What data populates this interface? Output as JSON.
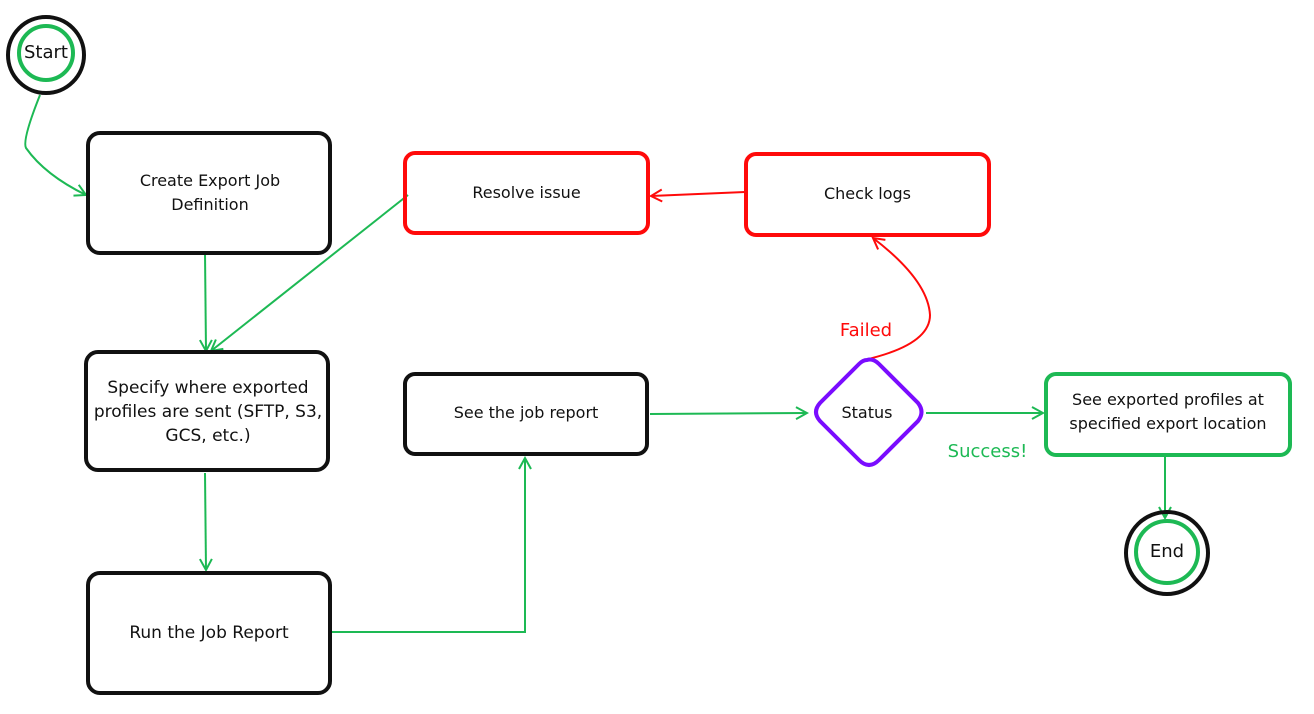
{
  "colors": {
    "black": "#111111",
    "green": "#1db954",
    "red": "#ff0a0a",
    "purple": "#7a0cff"
  },
  "nodes": {
    "start": "Start",
    "create_job": "Create Export Job Definition",
    "specify_destination": "Specify where exported profiles are sent (SFTP, S3, GCS, etc.)",
    "run_report": "Run the Job Report",
    "see_report": "See the job report",
    "status": "Status",
    "see_exported": "See exported profiles at specified export location",
    "end": "End",
    "resolve_issue": "Resolve issue",
    "check_logs": "Check logs"
  },
  "edge_labels": {
    "failed": "Failed",
    "success": "Success!"
  }
}
